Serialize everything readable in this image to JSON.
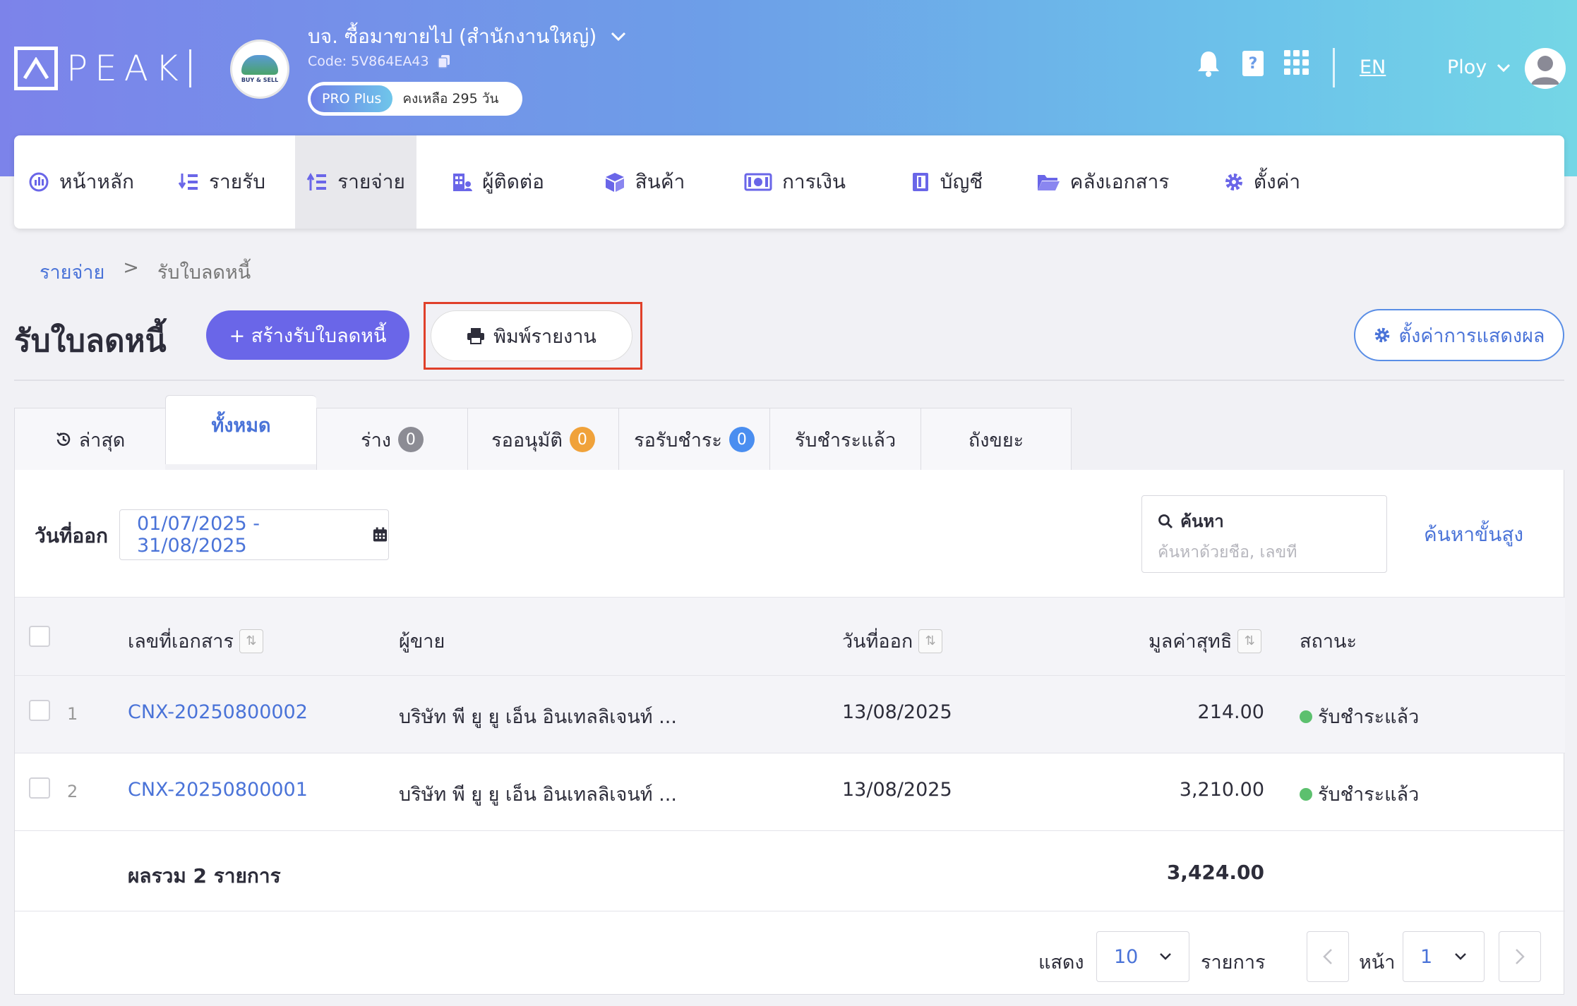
{
  "header": {
    "logo_text": "PEAK",
    "company_name": "บจ. ซื้อมาขายไป (สำนักงานใหญ่)",
    "company_code": "Code: 5V864EA43",
    "company_logo_text": "BUY & SELL",
    "plan_badge": "PRO Plus",
    "plan_remaining": "คงเหลือ 295 วัน",
    "language": "EN",
    "user_name": "Ploy"
  },
  "nav": {
    "items": [
      {
        "label": "หน้าหลัก",
        "icon": "dashboard-icon"
      },
      {
        "label": "รายรับ",
        "icon": "income-icon"
      },
      {
        "label": "รายจ่าย",
        "icon": "expense-icon"
      },
      {
        "label": "ผู้ติดต่อ",
        "icon": "contacts-icon"
      },
      {
        "label": "สินค้า",
        "icon": "product-box-icon"
      },
      {
        "label": "การเงิน",
        "icon": "money-icon"
      },
      {
        "label": "บัญชี",
        "icon": "book-icon"
      },
      {
        "label": "คลังเอกสาร",
        "icon": "folder-icon"
      },
      {
        "label": "ตั้งค่า",
        "icon": "gear-icon"
      }
    ],
    "active": "รายจ่าย"
  },
  "breadcrumb": {
    "parent": "รายจ่าย",
    "separator": ">",
    "current": "รับใบลดหนี้"
  },
  "page": {
    "title": "รับใบลดหนี้",
    "create_button": "+ สร้างรับใบลดหนี้",
    "print_button": "พิมพ์รายงาน",
    "display_settings_button": "ตั้งค่าการแสดงผล"
  },
  "tabs": [
    {
      "label": "ล่าสุด"
    },
    {
      "label": "ทั้งหมด"
    },
    {
      "label": "ร่าง",
      "count": "0"
    },
    {
      "label": "รออนุมัติ",
      "count": "0"
    },
    {
      "label": "รอรับชำระ",
      "count": "0"
    },
    {
      "label": "รับชำระแล้ว"
    },
    {
      "label": "ถังขยะ"
    }
  ],
  "filter": {
    "date_label": "วันที่ออก",
    "date_range": "01/07/2025 - 31/08/2025",
    "search_label": "ค้นหา",
    "search_placeholder": "ค้นหาด้วยชื่อ, เลขที่",
    "advanced_search": "ค้นหาขั้นสูง"
  },
  "table": {
    "columns": {
      "doc_no": "เลขที่เอกสาร",
      "vendor": "ผู้ขาย",
      "issue_date": "วันที่ออก",
      "net_value": "มูลค่าสุทธิ",
      "status": "สถานะ"
    },
    "rows": [
      {
        "index": "1",
        "doc_no": "CNX-20250800002",
        "vendor": "บริษัท พี ยู ยู เอ็น อินเทลลิเจนท์ ...",
        "issue_date": "13/08/2025",
        "net_value": "214.00",
        "status": "รับชำระแล้ว"
      },
      {
        "index": "2",
        "doc_no": "CNX-20250800001",
        "vendor": "บริษัท พี ยู ยู เอ็น อินเทลลิเจนท์ ...",
        "issue_date": "13/08/2025",
        "net_value": "3,210.00",
        "status": "รับชำระแล้ว"
      }
    ],
    "total_label": "ผลรวม 2 รายการ",
    "total_value": "3,424.00"
  },
  "pagination": {
    "show_label": "แสดง",
    "page_size": "10",
    "items_label": "รายการ",
    "page_label": "หน้า",
    "page_number": "1"
  },
  "colors": {
    "accent": "#6a66e8",
    "link": "#4a73d8",
    "highlight_border": "#e0402a",
    "status_paid": "#5cc06e"
  }
}
